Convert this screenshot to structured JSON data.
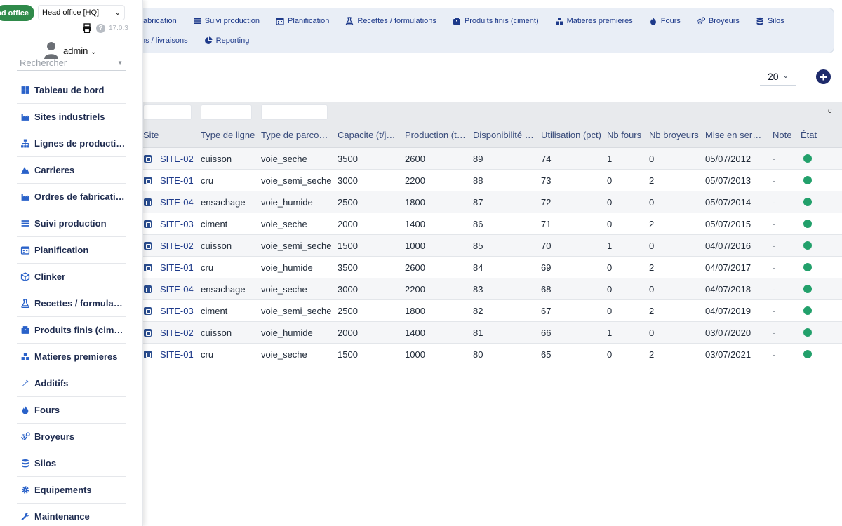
{
  "top_nav": {
    "row1": [
      {
        "label": "fabrication",
        "icon": "none"
      },
      {
        "label": "Suivi production",
        "icon": "list-icon"
      },
      {
        "label": "Planification",
        "icon": "calendar-icon"
      },
      {
        "label": "Recettes / formulations",
        "icon": "flask-icon"
      },
      {
        "label": "Produits finis (ciment)",
        "icon": "box-icon"
      },
      {
        "label": "Matieres premieres",
        "icon": "cubes-icon"
      },
      {
        "label": "Fours",
        "icon": "flame-icon"
      },
      {
        "label": "Broyeurs",
        "icon": "gears-icon"
      },
      {
        "label": "Silos",
        "icon": "database-icon"
      }
    ],
    "row2": [
      {
        "label": "ns / livraisons",
        "icon": "none"
      },
      {
        "label": "Reporting",
        "icon": "pie-chart-icon"
      }
    ]
  },
  "pager": {
    "page_size": "20"
  },
  "sidebar": {
    "office_button": "ad office",
    "office_select": "Head office [HQ]",
    "version": "17.0.3",
    "user": "admin",
    "search_placeholder": "Rechercher",
    "items": [
      {
        "label": "Tableau de bord",
        "icon": "dashboard-icon"
      },
      {
        "label": "Sites industriels",
        "icon": "factory-icon"
      },
      {
        "label": "Lignes de production",
        "icon": "sitemap-icon"
      },
      {
        "label": "Carrieres",
        "icon": "mountain-icon"
      },
      {
        "label": "Ordres de fabrication",
        "icon": "factory-icon"
      },
      {
        "label": "Suivi production",
        "icon": "list-icon"
      },
      {
        "label": "Planification",
        "icon": "calendar-icon"
      },
      {
        "label": "Clinker",
        "icon": "cube-icon"
      },
      {
        "label": "Recettes / formulatio…",
        "icon": "flask-icon"
      },
      {
        "label": "Produits finis (ciment)",
        "icon": "box-icon"
      },
      {
        "label": "Matieres premieres",
        "icon": "cubes-icon"
      },
      {
        "label": "Additifs",
        "icon": "eyedropper-icon"
      },
      {
        "label": "Fours",
        "icon": "flame-icon"
      },
      {
        "label": "Broyeurs",
        "icon": "gears-icon"
      },
      {
        "label": "Silos",
        "icon": "database-icon"
      },
      {
        "label": "Equipements",
        "icon": "gear-icon"
      },
      {
        "label": "Maintenance",
        "icon": "wrench-icon"
      }
    ]
  },
  "table": {
    "columns": [
      "Site",
      "Type de ligne",
      "Type de parcours",
      "Capacite (t/j…",
      "Production (t…",
      "Disponibilité …",
      "Utilisation (pct)",
      "Nb fours",
      "Nb broyeurs",
      "Mise en serv…",
      "Note",
      "État"
    ],
    "rows": [
      {
        "site": "SITE-02",
        "type_ligne": "cuisson",
        "parcours": "voie_seche",
        "capacite": "3500",
        "production": "2600",
        "dispo": "89",
        "util": "74",
        "fours": "1",
        "broyeurs": "0",
        "mise": "05/07/2012",
        "note": "-",
        "etat": "active"
      },
      {
        "site": "SITE-01",
        "type_ligne": "cru",
        "parcours": "voie_semi_seche",
        "capacite": "3000",
        "production": "2200",
        "dispo": "88",
        "util": "73",
        "fours": "0",
        "broyeurs": "2",
        "mise": "05/07/2013",
        "note": "-",
        "etat": "active"
      },
      {
        "site": "SITE-04",
        "type_ligne": "ensachage",
        "parcours": "voie_humide",
        "capacite": "2500",
        "production": "1800",
        "dispo": "87",
        "util": "72",
        "fours": "0",
        "broyeurs": "0",
        "mise": "05/07/2014",
        "note": "-",
        "etat": "active"
      },
      {
        "site": "SITE-03",
        "type_ligne": "ciment",
        "parcours": "voie_seche",
        "capacite": "2000",
        "production": "1400",
        "dispo": "86",
        "util": "71",
        "fours": "0",
        "broyeurs": "2",
        "mise": "05/07/2015",
        "note": "-",
        "etat": "active"
      },
      {
        "site": "SITE-02",
        "type_ligne": "cuisson",
        "parcours": "voie_semi_seche",
        "capacite": "1500",
        "production": "1000",
        "dispo": "85",
        "util": "70",
        "fours": "1",
        "broyeurs": "0",
        "mise": "04/07/2016",
        "note": "-",
        "etat": "active"
      },
      {
        "site": "SITE-01",
        "type_ligne": "cru",
        "parcours": "voie_humide",
        "capacite": "3500",
        "production": "2600",
        "dispo": "84",
        "util": "69",
        "fours": "0",
        "broyeurs": "2",
        "mise": "04/07/2017",
        "note": "-",
        "etat": "active"
      },
      {
        "site": "SITE-04",
        "type_ligne": "ensachage",
        "parcours": "voie_seche",
        "capacite": "3000",
        "production": "2200",
        "dispo": "83",
        "util": "68",
        "fours": "0",
        "broyeurs": "0",
        "mise": "04/07/2018",
        "note": "-",
        "etat": "active"
      },
      {
        "site": "SITE-03",
        "type_ligne": "ciment",
        "parcours": "voie_semi_seche",
        "capacite": "2500",
        "production": "1800",
        "dispo": "82",
        "util": "67",
        "fours": "0",
        "broyeurs": "2",
        "mise": "04/07/2019",
        "note": "-",
        "etat": "active"
      },
      {
        "site": "SITE-02",
        "type_ligne": "cuisson",
        "parcours": "voie_humide",
        "capacite": "2000",
        "production": "1400",
        "dispo": "81",
        "util": "66",
        "fours": "1",
        "broyeurs": "0",
        "mise": "03/07/2020",
        "note": "-",
        "etat": "active"
      },
      {
        "site": "SITE-01",
        "type_ligne": "cru",
        "parcours": "voie_seche",
        "capacite": "1500",
        "production": "1000",
        "dispo": "80",
        "util": "65",
        "fours": "0",
        "broyeurs": "2",
        "mise": "03/07/2021",
        "note": "-",
        "etat": "active"
      }
    ]
  },
  "colors": {
    "accent": "#1e3a8a",
    "status_active": "#22a06b",
    "office_green": "#2f8a4a"
  }
}
